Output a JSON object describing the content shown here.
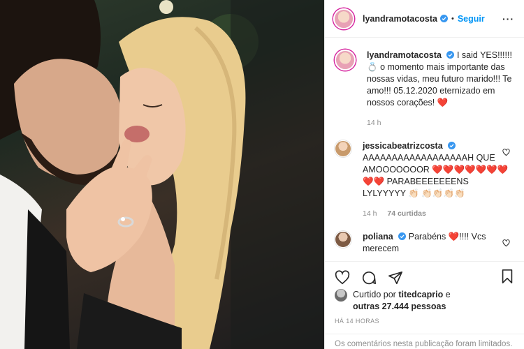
{
  "header": {
    "username": "lyandramotacosta",
    "dot": "•",
    "follow_label": "Seguir"
  },
  "caption": {
    "username": "lyandramotacosta",
    "text_line1": "I said YES!!!!!! 💍",
    "text_rest": "o momento mais importante das nossas vidas, meu futuro marido!!! Te amo!!! 05.12.2020 eternizado em nossos corações! ❤️",
    "time": "14 h"
  },
  "comments": [
    {
      "username": "jessicabeatrizcosta",
      "text": "AAAAAAAAAAAAAAAAAAH QUE AMOOOOOOOR ❤️❤️❤️❤️❤️❤️❤️❤️❤️ PARABEEEEEEENS LYLYYYYY 👏🏻 👏🏻👏🏻👏🏻👏🏻",
      "time": "14 h",
      "likes": "74 curtidas"
    },
    {
      "username": "poliana",
      "text": "Parabéns ❤️!!!! Vcs merecem"
    }
  ],
  "likes": {
    "prefix": "Curtido por",
    "by_user": "titedcaprio",
    "conj": "e",
    "others": "outras 27.444 pessoas"
  },
  "timestamp": "HÁ 14 HORAS",
  "limited_notice": "Os comentários nesta publicação foram limitados.",
  "colors": {
    "accent": "#0095f6",
    "heart": "#ed4956",
    "muted": "#8e8e8e"
  },
  "icons": [
    "verified-icon",
    "heart-icon",
    "comment-icon",
    "share-icon",
    "bookmark-icon",
    "more-icon"
  ]
}
